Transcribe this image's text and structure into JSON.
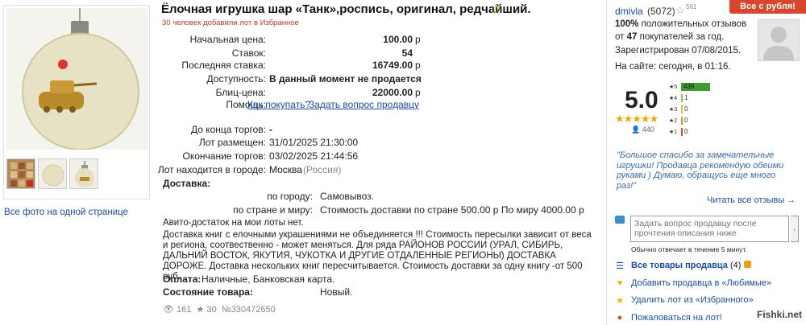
{
  "lot": {
    "title": "Ёлочная игрушка шар «Танк»,роспись, оригинал, редчайший.",
    "favorites_note": "30 человек добавили лот в Избранное",
    "all_photos": "Все фото на одной странице"
  },
  "price": {
    "start_label": "Начальная цена:",
    "start_value": "100.00",
    "bids_label": "Ставок:",
    "bids_value": "54",
    "last_label": "Последняя ставка:",
    "last_value": "16749.00",
    "avail_label": "Доступность:",
    "avail_value": "В данный момент не продается",
    "blitz_label": "Блиц-цена:",
    "blitz_value": "22000.00",
    "currency": "р",
    "help_label": "Помощь:",
    "help_link1": "Как покупать?",
    "help_link2": "Задать вопрос продавцу"
  },
  "timing": {
    "end_label": "До конца торгов:",
    "end_value": "-",
    "posted_label": "Лот размещен:",
    "posted_value": "31/01/2025 21:30:00",
    "finish_label": "Окончание торгов:",
    "finish_value": "03/02/2025 21:44:56",
    "city_label": "Лот находится в городе:",
    "city_value": "Москва",
    "country": "(Россия)"
  },
  "delivery": {
    "heading": "Доставка:",
    "city_label": "по городу:",
    "city_value": "Самовывоз.",
    "world_label": "по стране и миру:",
    "world_value": "Стоимость доставки по стране 500.00 р По миру 4000.00 р",
    "line1": "Авито-достаток на мои лоты нет.",
    "text": "Доставка книг с елочными украшениями не объединяется !!! Стоимость пересылки зависит от веса и региона, соотвественно - может меняться. Для ряда РАЙОНОВ РОССИИ (УРАЛ, СИБИРЬ, ДАЛЬНИЙ ВОСТОК, ЯКУТИЯ, ЧУКОТКА И ДРУГИЕ ОТДАЛЕННЫЕ РЕГИОНЫ) ДОСТАВКА ДОРОЖЕ. Доставка нескольких книг пересчитывается. Стоимость доставки за одну книгу -от 500 руб."
  },
  "payment": {
    "label": "Оплата:",
    "value": "Наличные, Банковская карта."
  },
  "condition": {
    "label": "Состояние товара:",
    "value": "Новый."
  },
  "stats": {
    "views": "161",
    "stars": "30",
    "lot_no": "№330472650"
  },
  "seller": {
    "name": "dmivla",
    "reputation": "(5072)",
    "rep_small": "561",
    "badge": "Все с рубля!",
    "positive_pct": "100%",
    "positive_text": "положительных отзывов",
    "from_prefix": "от",
    "from_count": "47",
    "from_suffix": "покупателей за год.",
    "registered": "Зарегистрирован 07/08/2015.",
    "online": "На сайте: сегодня, в 01:16.",
    "rating": "5.0",
    "rating_stars": "★★★★★",
    "reviews_total": "440",
    "bars": [
      {
        "label": "★5",
        "count": "439",
        "fraction": 1.0,
        "color": "#3d9c2d"
      },
      {
        "label": "★4",
        "count": "1",
        "fraction": 0.0,
        "color": "#8bc34a"
      },
      {
        "label": "★3",
        "count": "0",
        "fraction": 0.0,
        "color": "#e0c020"
      },
      {
        "label": "★2",
        "count": "0",
        "fraction": 0.0,
        "color": "#f08a24"
      },
      {
        "label": "★1",
        "count": "0",
        "fraction": 0.0,
        "color": "#e04a2d"
      }
    ],
    "quote": "\"Большое спасибо за замечательные игрушки! Продавца рекомендую обеими руками ) Думаю, обращусь еще много раз!\"",
    "read_all": "Читать все отзывы →",
    "ask_placeholder": "Задать вопрос продавцу после прочтения описания ниже",
    "ask_btn": "↓",
    "reply_note": "Обычно отвечает в течение 5 минут.",
    "actions": {
      "all_items": "Все товары продавца",
      "all_items_count": "(4)",
      "add_fav": "Добавить продавца в «Любимые»",
      "remove_lot": "Удалить лот из «Избранного»",
      "report": "Пожаловаться на лот!"
    }
  },
  "watermark": "Fishki.net"
}
